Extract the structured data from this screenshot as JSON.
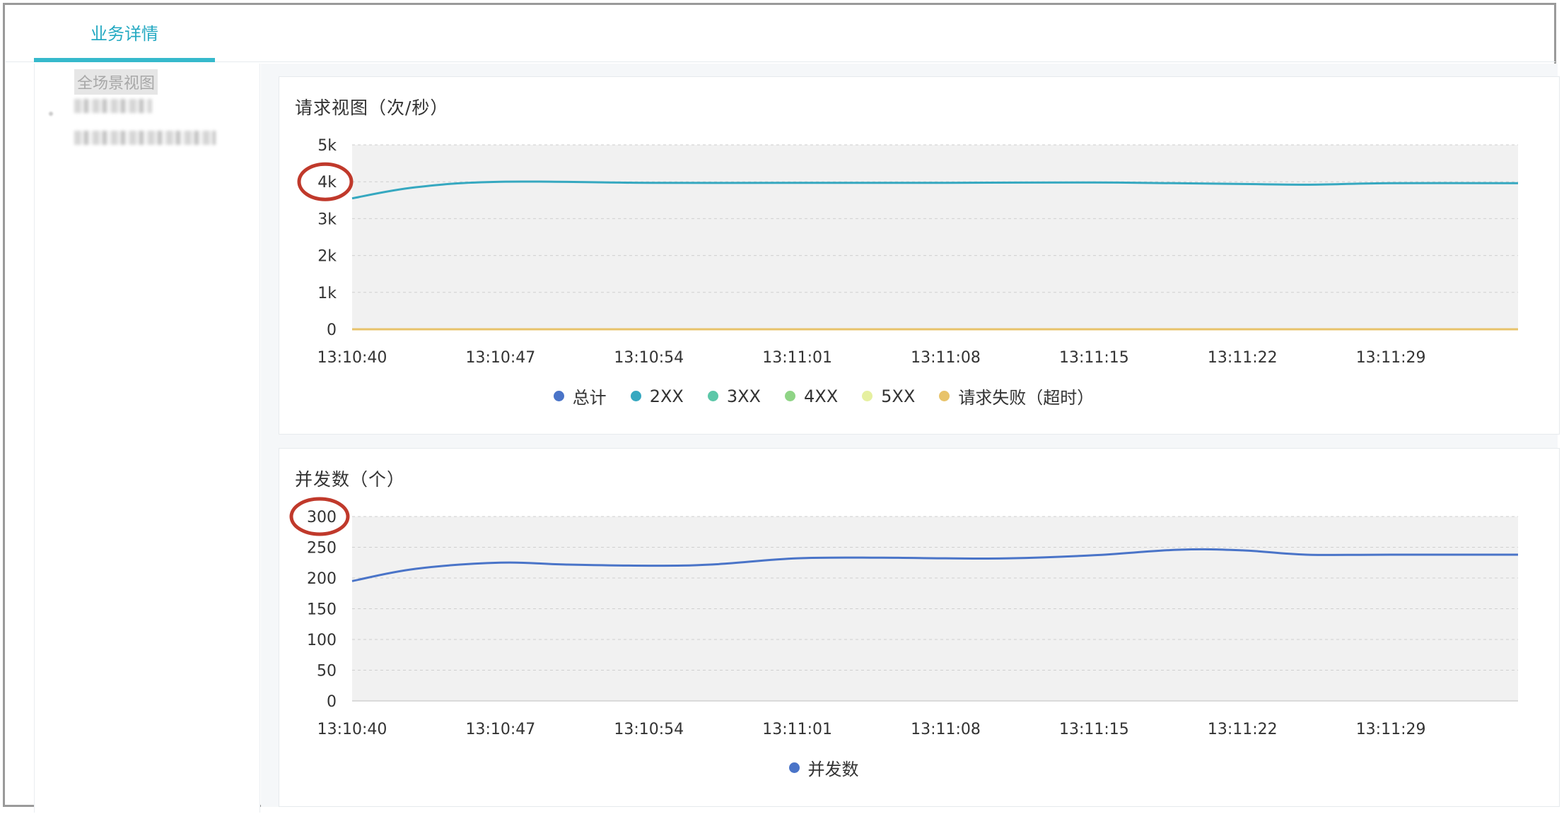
{
  "tabs": [
    {
      "label": "业务详情",
      "active": true
    }
  ],
  "sidebar": {
    "items": [
      {
        "label": "全场景视图"
      }
    ]
  },
  "colors": {
    "accent": "#36b9cc",
    "total": "#4a74c8",
    "2xx": "#36a8c0",
    "3xx": "#5cc7a8",
    "4xx": "#8fd486",
    "5xx": "#e6f0a0",
    "fail": "#e8c36a",
    "highlight_circle": "#c0392b"
  },
  "charts": [
    {
      "title": "请求视图（次/秒）",
      "legend": [
        {
          "label": "总计",
          "color": "#4a74c8"
        },
        {
          "label": "2XX",
          "color": "#36a8c0"
        },
        {
          "label": "3XX",
          "color": "#5cc7a8"
        },
        {
          "label": "4XX",
          "color": "#8fd486"
        },
        {
          "label": "5XX",
          "color": "#e6f0a0"
        },
        {
          "label": "请求失败（超时）",
          "color": "#e8c36a"
        }
      ]
    },
    {
      "title": "并发数（个）",
      "legend": [
        {
          "label": "并发数",
          "color": "#4a74c8"
        }
      ]
    }
  ],
  "chart_data": [
    {
      "type": "line",
      "title": "请求视图（次/秒）",
      "x_ticks": [
        "13:10:40",
        "13:10:47",
        "13:10:54",
        "13:11:01",
        "13:11:08",
        "13:11:15",
        "13:11:22",
        "13:11:29"
      ],
      "y_ticks": [
        "0",
        "1k",
        "2k",
        "3k",
        "4k",
        "5k"
      ],
      "ylim": [
        0,
        5000
      ],
      "xlim": [
        0,
        55
      ],
      "grid": true,
      "legend_position": "bottom-center",
      "highlighted_tick": "4k",
      "series": [
        {
          "name": "2XX",
          "color": "#36a8c0",
          "x": [
            0,
            3,
            7,
            14,
            21,
            28,
            35,
            42,
            45,
            49,
            55
          ],
          "y": [
            3550,
            3850,
            4000,
            3970,
            3970,
            3970,
            3980,
            3940,
            3920,
            3960,
            3960
          ]
        },
        {
          "name": "请求失败（超时）",
          "color": "#e8c36a",
          "x": [
            0,
            55
          ],
          "y": [
            0,
            0
          ]
        }
      ]
    },
    {
      "type": "line",
      "title": "并发数（个）",
      "x_ticks": [
        "13:10:40",
        "13:10:47",
        "13:10:54",
        "13:11:01",
        "13:11:08",
        "13:11:15",
        "13:11:22",
        "13:11:29"
      ],
      "y_ticks": [
        "0",
        "50",
        "100",
        "150",
        "200",
        "250",
        "300"
      ],
      "ylim": [
        0,
        300
      ],
      "xlim": [
        0,
        55
      ],
      "grid": true,
      "legend_position": "bottom-center",
      "highlighted_tick": "300",
      "series": [
        {
          "name": "并发数",
          "color": "#4a74c8",
          "x": [
            0,
            3,
            7,
            10,
            14,
            17,
            21,
            25,
            28,
            31,
            35,
            39,
            42,
            45,
            49,
            55
          ],
          "y": [
            195,
            215,
            225,
            222,
            220,
            222,
            232,
            233,
            232,
            232,
            237,
            246,
            245,
            238,
            238,
            238
          ]
        }
      ]
    }
  ]
}
